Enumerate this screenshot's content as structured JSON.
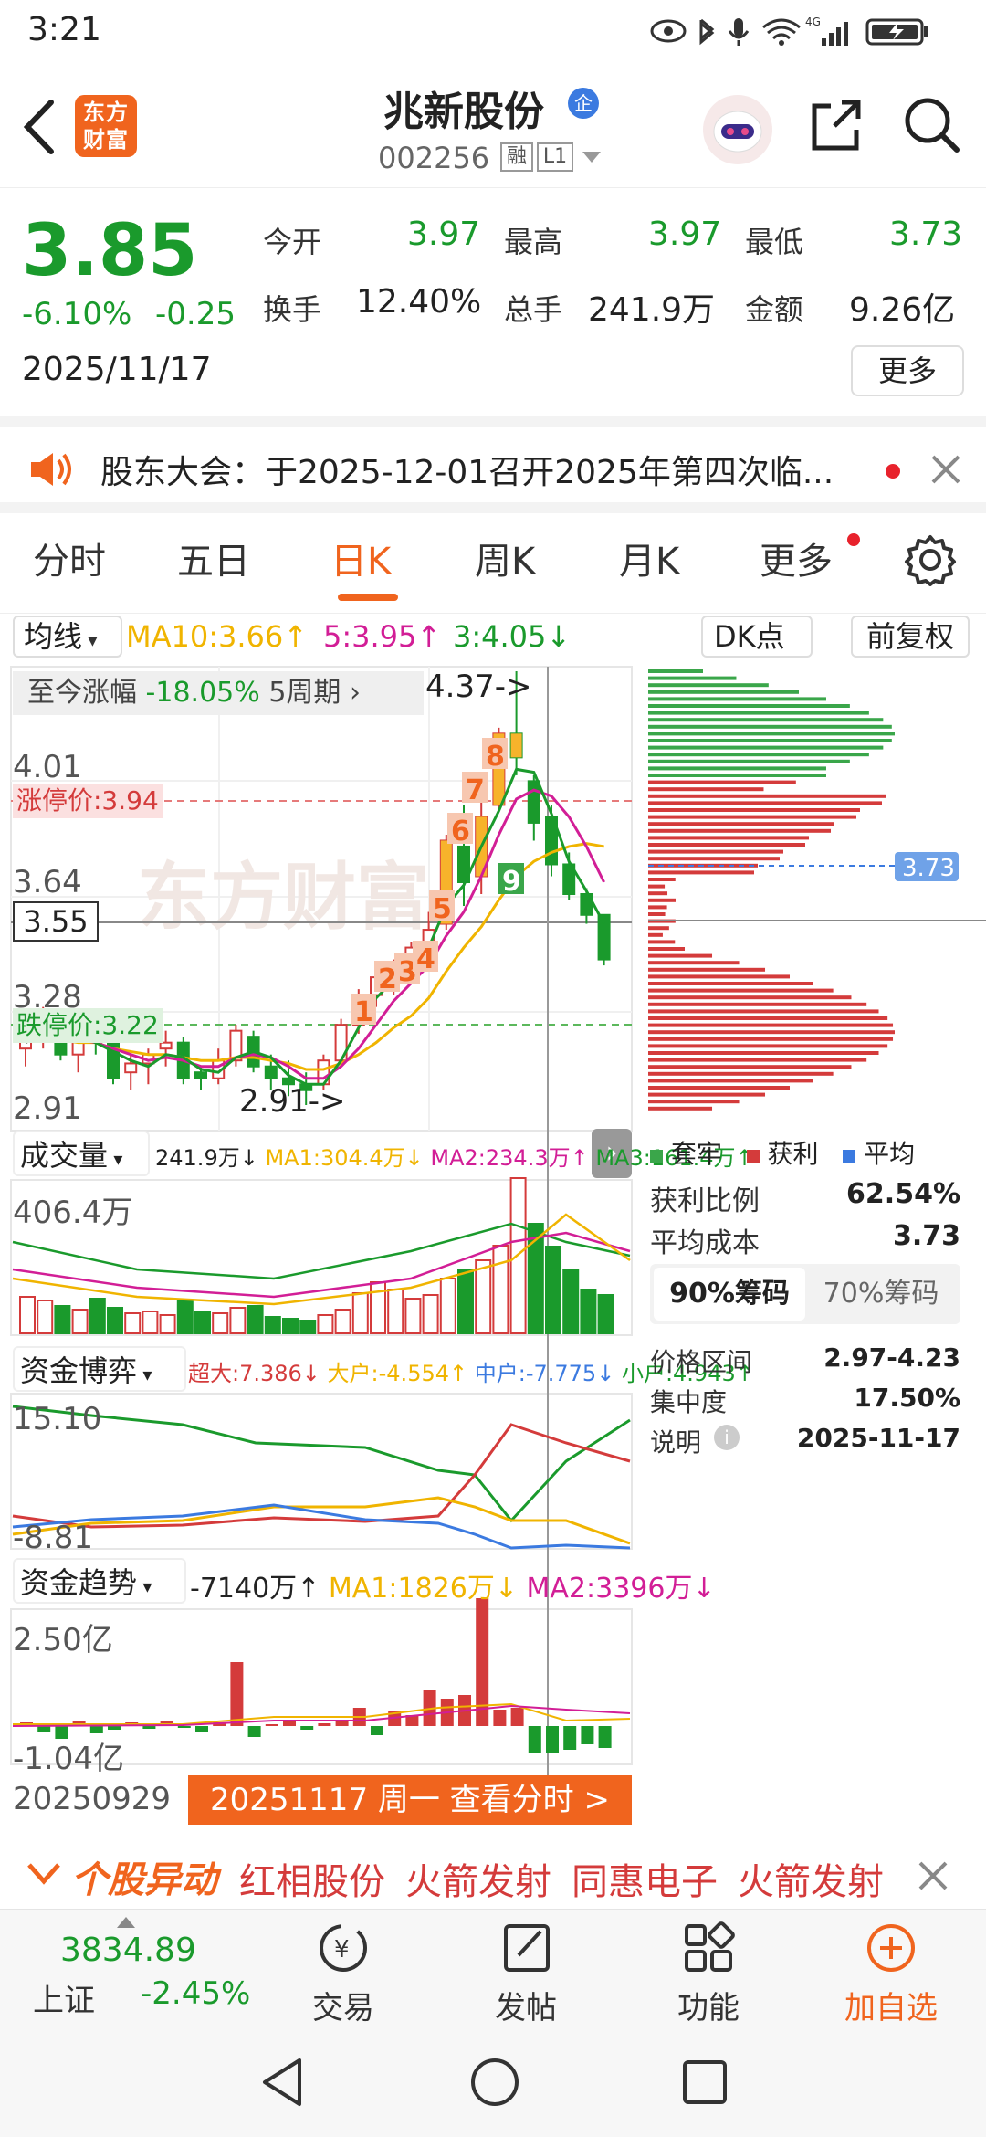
{
  "status_bar": {
    "time": "3:21",
    "net": "4G"
  },
  "header": {
    "logo_text": "东方财富",
    "stock_name": "兆新股份",
    "badge": "企",
    "stock_code": "002256",
    "tag_margin": "融",
    "tag_level": "L1"
  },
  "quote": {
    "price": "3.85",
    "change_pct": "-6.10%",
    "change_amt": "-0.25",
    "date": "2025/11/17",
    "open_label": "今开",
    "open": "3.97",
    "high_label": "最高",
    "high": "3.97",
    "low_label": "最低",
    "low": "3.73",
    "turnover_label": "换手",
    "turnover": "12.40%",
    "volume_label": "总手",
    "volume": "241.9万",
    "amount_label": "金额",
    "amount": "9.26亿",
    "more_label": "更多"
  },
  "notice": {
    "text": "股东大会：于2025-12-01召开2025年第四次临..."
  },
  "tabs": [
    "分时",
    "五日",
    "日K",
    "周K",
    "月K",
    "更多"
  ],
  "active_tab": "日K",
  "kline": {
    "ma_selector": "均线",
    "ma10": "MA10:3.66",
    "ma5": "5:3.95",
    "ma3": "3:4.05",
    "dk_label": "DK点",
    "fq_label": "前复权",
    "range_label": "至今涨幅",
    "range_value": "-18.05%",
    "range_period": "5周期",
    "high_marker": "4.37",
    "low_marker": "2.91",
    "y_labels": [
      "4.01",
      "3.64",
      "3.28",
      "2.91"
    ],
    "crosshair_price": "3.55",
    "limit_up": "涨停价:3.94",
    "limit_down": "跌停价:3.22",
    "chip_price": "3.73",
    "watermark": "东方财富"
  },
  "volume_section": {
    "selector": "成交量",
    "value": "241.9万",
    "ma1": "MA1:304.4万",
    "ma2": "MA2:234.3万",
    "ma3": "MA3:161.4万",
    "y_top": "406.4万"
  },
  "fund_game": {
    "selector": "资金博弈",
    "super": "超大:7.386",
    "big": "大户:-4.554",
    "mid": "中户:-7.775",
    "small": "小户:4.943",
    "y_top": "15.10",
    "y_bottom": "-8.81"
  },
  "fund_trend": {
    "selector": "资金趋势",
    "value": "-7140万",
    "ma1": "MA1:1826万",
    "ma2": "MA2:3396万",
    "y_top": "2.50亿",
    "y_bottom": "-1.04亿",
    "start_date": "20250929",
    "cursor_label": "20251117 周一 查看分时 >"
  },
  "chip_panel": {
    "legend": [
      "套牢",
      "获利",
      "平均"
    ],
    "profit_ratio_label": "获利比例",
    "profit_ratio": "62.54%",
    "avg_cost_label": "平均成本",
    "avg_cost": "3.73",
    "tab90": "90%筹码",
    "tab70": "70%筹码",
    "price_range_label": "价格区间",
    "price_range": "2.97-4.23",
    "concentration_label": "集中度",
    "concentration": "17.50%",
    "note_label": "说明",
    "note_date": "2025-11-17"
  },
  "ticker": {
    "title": "个股异动",
    "items": [
      "红相股份",
      "火箭发射",
      "同惠电子",
      "火箭发射"
    ]
  },
  "bottom_nav": {
    "index_value": "3834.89",
    "index_name": "上证",
    "index_change": "-2.45%",
    "trade": "交易",
    "post": "发帖",
    "func": "功能",
    "add": "加自选"
  },
  "colors": {
    "accent": "#f0641e",
    "up": "#d43b3b",
    "down": "#1a9a2c",
    "ma10": "#f0b400",
    "ma5": "#d21e96",
    "ma3": "#1a9a2c"
  }
}
